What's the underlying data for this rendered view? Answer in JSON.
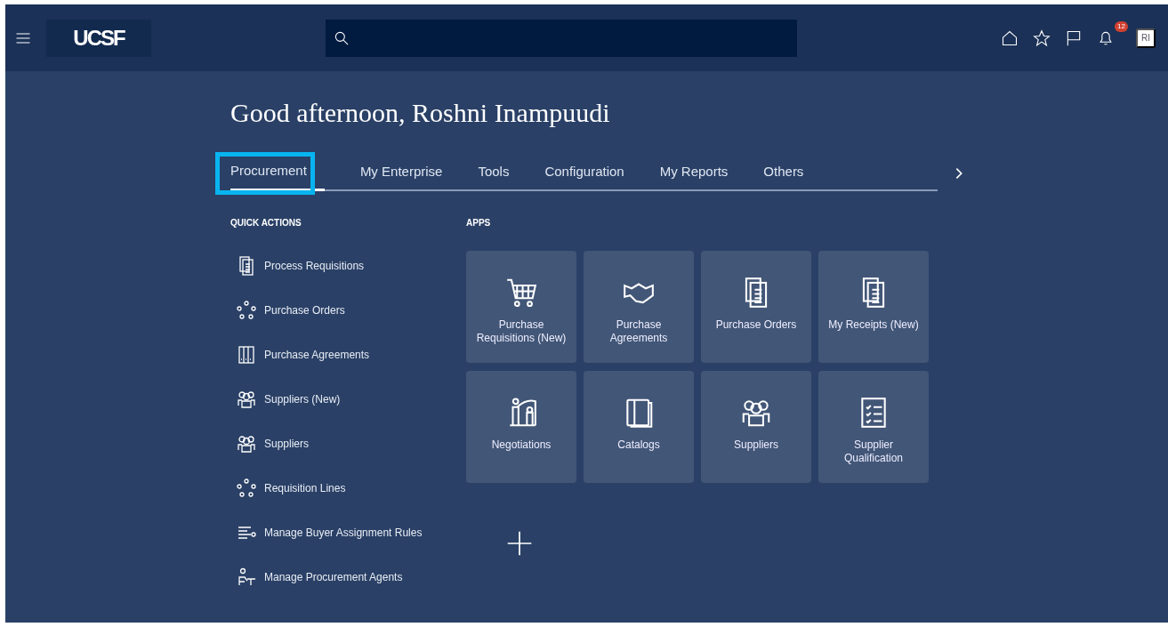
{
  "header": {
    "logo": "UCSF",
    "notifications": "12",
    "avatar": "RI"
  },
  "greeting": "Good afternoon, Roshni Inampuudi",
  "tabs": [
    {
      "label": "Procurement",
      "selected": true,
      "highlighted": true
    },
    {
      "label": "My Enterprise",
      "selected": false,
      "highlighted": false
    },
    {
      "label": "Tools",
      "selected": false,
      "highlighted": false
    },
    {
      "label": "Configuration",
      "selected": false,
      "highlighted": false
    },
    {
      "label": "My Reports",
      "selected": false,
      "highlighted": false
    },
    {
      "label": "Others",
      "selected": false,
      "highlighted": false
    }
  ],
  "quick_actions": {
    "title": "QUICK ACTIONS",
    "items": [
      "Process Requisitions",
      "Purchase Orders",
      "Purchase Agreements",
      "Suppliers (New)",
      "Suppliers",
      "Requisition Lines",
      "Manage Buyer Assignment Rules",
      "Manage Procurement Agents"
    ]
  },
  "apps": {
    "title": "APPS",
    "tiles": [
      "Purchase Requisitions (New)",
      "Purchase Agreements",
      "Purchase Orders",
      "My Receipts (New)",
      "Negotiations",
      "Catalogs",
      "Suppliers",
      "Supplier Qualification"
    ]
  }
}
